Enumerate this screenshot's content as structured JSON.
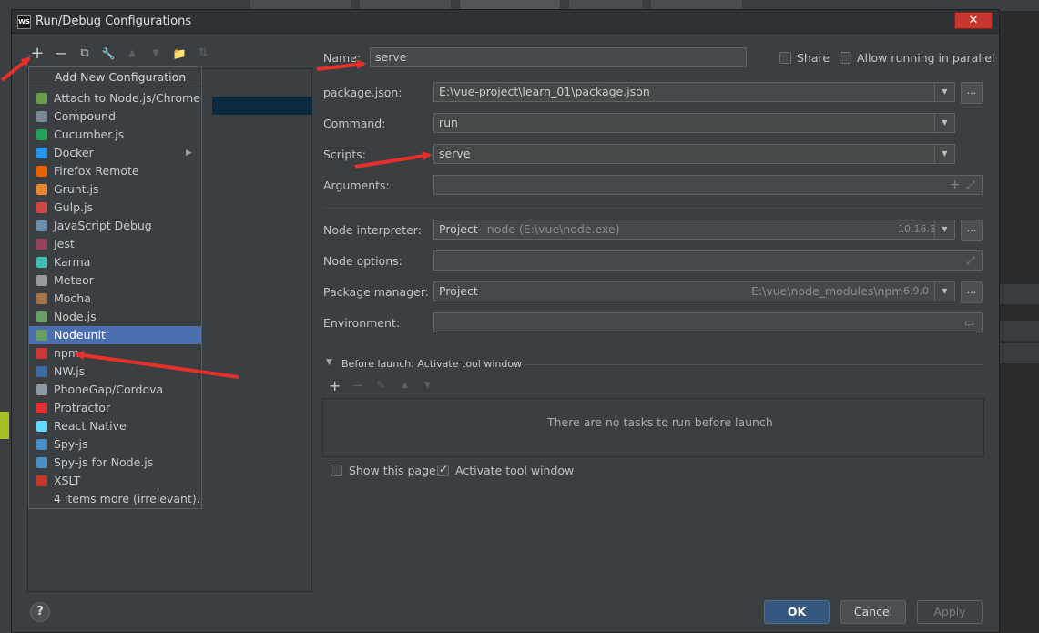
{
  "window": {
    "title": "Run/Debug Configurations",
    "app_badge": "WS",
    "close_glyph": "✕"
  },
  "toolbar": {
    "add_glyph": "+",
    "remove_glyph": "−",
    "copy_glyph": "⧉",
    "edit_glyph": "🔧",
    "up_glyph": "▲",
    "down_glyph": "▼",
    "folder_glyph": "📁",
    "sort_glyph": "⇅"
  },
  "popup": {
    "header": "Add New Configuration",
    "items": [
      {
        "label": "Attach to Node.js/Chrome",
        "icon": "attach-icon",
        "color": "#6a9f4a"
      },
      {
        "label": "Compound",
        "icon": "compound-icon",
        "color": "#7a8a9a"
      },
      {
        "label": "Cucumber.js",
        "icon": "cucumber-icon",
        "color": "#23a35a"
      },
      {
        "label": "Docker",
        "icon": "docker-icon",
        "color": "#2496ed"
      },
      {
        "label": "Firefox Remote",
        "icon": "firefox-icon",
        "color": "#e66000"
      },
      {
        "label": "Grunt.js",
        "icon": "grunt-icon",
        "color": "#e48632"
      },
      {
        "label": "Gulp.js",
        "icon": "gulp-icon",
        "color": "#cf4647"
      },
      {
        "label": "JavaScript Debug",
        "icon": "js-debug-icon",
        "color": "#6b8fb0"
      },
      {
        "label": "Jest",
        "icon": "jest-icon",
        "color": "#99425b"
      },
      {
        "label": "Karma",
        "icon": "karma-icon",
        "color": "#3cbeb1"
      },
      {
        "label": "Meteor",
        "icon": "meteor-icon",
        "color": "#9a9a9a"
      },
      {
        "label": "Mocha",
        "icon": "mocha-icon",
        "color": "#a9754b"
      },
      {
        "label": "Node.js",
        "icon": "nodejs-icon",
        "color": "#68a063"
      },
      {
        "label": "Nodeunit",
        "icon": "nodeunit-icon",
        "color": "#68a063"
      },
      {
        "label": "npm",
        "icon": "npm-icon",
        "color": "#cb3837"
      },
      {
        "label": "NW.js",
        "icon": "nwjs-icon",
        "color": "#3a6ea5"
      },
      {
        "label": "PhoneGap/Cordova",
        "icon": "phonegap-icon",
        "color": "#8d9ba8"
      },
      {
        "label": "Protractor",
        "icon": "protractor-icon",
        "color": "#e23237"
      },
      {
        "label": "React Native",
        "icon": "react-icon",
        "color": "#61dafb"
      },
      {
        "label": "Spy-js",
        "icon": "spyjs-icon",
        "color": "#4a90c8"
      },
      {
        "label": "Spy-js for Node.js",
        "icon": "spyjs-node-icon",
        "color": "#4a90c8"
      },
      {
        "label": "XSLT",
        "icon": "xslt-icon",
        "color": "#c0392b"
      },
      {
        "label": "4 items more (irrelevant)...",
        "icon": "",
        "color": ""
      }
    ],
    "selected_index": 13,
    "submenu_arrow": "▶"
  },
  "form": {
    "name_label": "Name:",
    "name_value": "serve",
    "share_label": "Share",
    "parallel_label": "Allow running in parallel",
    "package_json_label": "package.json:",
    "package_json_value": "E:\\vue-project\\learn_01\\package.json",
    "command_label": "Command:",
    "command_value": "run",
    "scripts_label": "Scripts:",
    "scripts_value": "serve",
    "arguments_label": "Arguments:",
    "interpreter_label": "Node interpreter:",
    "interpreter_value": "Project",
    "interpreter_path": "node (E:\\vue\\node.exe)",
    "interpreter_version": "10.16.3",
    "node_options_label": "Node options:",
    "package_manager_label": "Package manager:",
    "package_manager_value": "Project",
    "package_manager_path": "E:\\vue\\node_modules\\npm",
    "package_manager_version": "6.9.0",
    "environment_label": "Environment:",
    "dots": "..."
  },
  "before_launch": {
    "title": "Before launch: Activate tool window",
    "empty_text": "There are no tasks to run before launch",
    "show_page_label": "Show this page",
    "activate_label": "Activate tool window"
  },
  "buttons": {
    "ok": "OK",
    "cancel": "Cancel",
    "apply": "Apply",
    "help": "?"
  },
  "colors": {
    "annotation_red": "#e8302a",
    "selection_blue": "#4b6eaf",
    "ok_blue": "#365880"
  }
}
